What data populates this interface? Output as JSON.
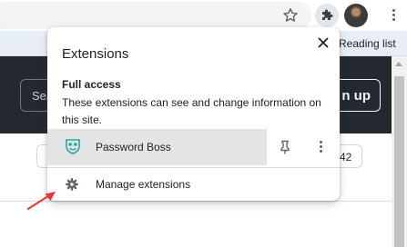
{
  "toolbar": {
    "star_icon": "star-icon",
    "extensions_icon": "puzzle-piece-icon",
    "avatar": "profile-avatar",
    "menu_icon": "vertical-dots-icon"
  },
  "bookmarks_bar": {
    "reading_list_label": "Reading list"
  },
  "page": {
    "search_fragment": "Sea",
    "signup_fragment": "n up",
    "count_fragment": "42"
  },
  "popup": {
    "title": "Extensions",
    "section_title": "Full access",
    "section_description": "These extensions can see and change information on this site.",
    "extensions": [
      {
        "name": "Password Boss",
        "icon": "password-boss-icon",
        "pinned": false
      }
    ],
    "manage_label": "Manage extensions"
  },
  "colors": {
    "accent_arrow": "#e53935",
    "hover_row": "#e4e4e4",
    "dark_header": "#24292f",
    "extension_icon": "#26a69a"
  }
}
